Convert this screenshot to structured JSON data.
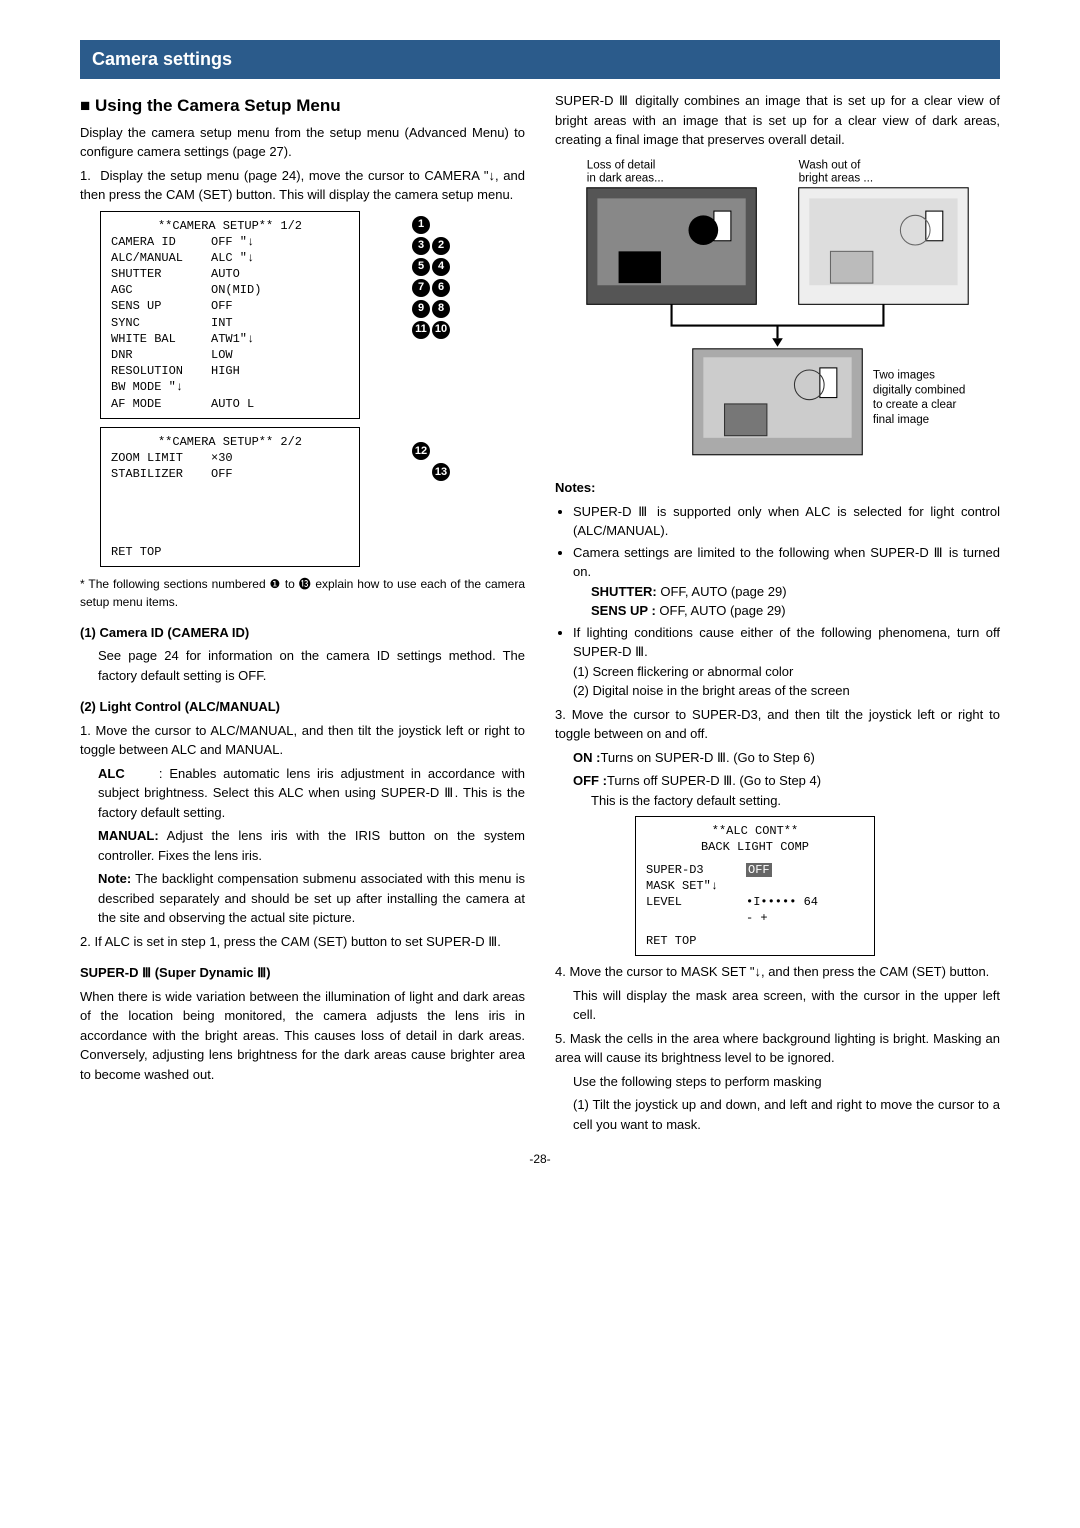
{
  "title_bar": "Camera settings",
  "left": {
    "h_using": "Using the Camera Setup Menu",
    "intro": "Display the camera setup menu from the setup menu (Advanced Menu) to configure camera settings (page 27).",
    "step1": "Display the setup menu (page 24), move the cursor to CAMERA \"↓, and then press the CAM (SET) button. This will display the camera setup menu.",
    "osd1": {
      "header": "**CAMERA SETUP** 1/2",
      "rows": [
        {
          "lbl": "CAMERA ID",
          "val": "OFF \"↓"
        },
        {
          "lbl": "ALC/MANUAL",
          "val": "ALC \"↓"
        },
        {
          "lbl": "SHUTTER",
          "val": "AUTO"
        },
        {
          "lbl": "AGC",
          "val": "ON(MID)"
        },
        {
          "lbl": "SENS UP",
          "val": "OFF"
        },
        {
          "lbl": "SYNC",
          "val": "INT"
        },
        {
          "lbl": "WHITE BAL",
          "val": "ATW1\"↓"
        },
        {
          "lbl": "DNR",
          "val": "LOW"
        },
        {
          "lbl": "RESOLUTION",
          "val": "HIGH"
        },
        {
          "lbl": "BW MODE \"↓",
          "val": ""
        },
        {
          "lbl": "AF MODE",
          "val": "AUTO L"
        }
      ]
    },
    "osd2": {
      "header": "**CAMERA SETUP** 2/2",
      "rows": [
        {
          "lbl": "ZOOM LIMIT",
          "val": "×30"
        },
        {
          "lbl": "STABILIZER",
          "val": "OFF"
        }
      ],
      "footer": "RET TOP"
    },
    "footnote": "* The following sections numbered ❶ to ⓭ explain how to use each of the camera setup menu items.",
    "sec1_h": "(1) Camera ID (CAMERA ID)",
    "sec1_p": "See page 24 for information on the camera ID settings method. The factory default setting is OFF.",
    "sec2_h": "(2) Light Control (ALC/MANUAL)",
    "sec2_s1": "Move the cursor to ALC/MANUAL, and then tilt the joystick left or right to toggle between ALC and MANUAL.",
    "alc_lbl": "ALC",
    "alc_txt": ": Enables automatic lens iris adjustment in accordance with subject brightness. Select this ALC when using SUPER-D Ⅲ. This is the factory default setting.",
    "man_lbl": "MANUAL:",
    "man_txt": " Adjust the lens iris with the IRIS button on the system controller. Fixes the lens iris.",
    "note_lbl": "Note:",
    "note_txt": " The backlight compensation submenu associated with this menu is described separately and should be set up after installing the camera at the site and observing the actual site picture.",
    "sec2_s2": "If ALC is set in step 1, press the CAM (SET) button to set SUPER-D Ⅲ.",
    "sd3_h": "SUPER-D Ⅲ (Super Dynamic Ⅲ)",
    "sd3_p": "When there is wide variation between the illumination of light and dark areas of the location being monitored, the camera adjusts the lens iris in accordance with the bright areas. This causes loss of detail in dark areas. Conversely, adjusting lens brightness for the dark areas cause brighter area to become washed out."
  },
  "right": {
    "sd3_cont": "SUPER-D Ⅲ digitally combines an image that is set up for a clear view of bright areas with an image that is set up for a clear view of dark areas, creating a final image that preserves overall detail.",
    "fig": {
      "lbl_dark": "Loss of detail\nin dark areas...",
      "lbl_bright": "Wash out of\nbright areas ...",
      "lbl_combined": "Two images digitally combined to create a clear final image"
    },
    "notes_h": "Notes:",
    "note1": "SUPER-D Ⅲ is supported only when ALC is selected for light control (ALC/MANUAL).",
    "note2": "Camera settings are limited to the following when SUPER-D Ⅲ is turned on.",
    "n2_shutter_l": "SHUTTER:",
    "n2_shutter_v": "OFF, AUTO (page 29)",
    "n2_sens_l": "SENS UP :",
    "n2_sens_v": "OFF, AUTO (page 29)",
    "note3": "If lighting conditions cause either of the following phenomena, turn off SUPER-D Ⅲ.",
    "n3_1": "(1) Screen flickering or abnormal color",
    "n3_2": "(2) Digital noise in the bright areas of the screen",
    "step3": "Move the cursor to SUPER-D3, and then tilt the joystick left or right to toggle between on and off.",
    "on_l": "ON  :",
    "on_v": "Turns on SUPER-D Ⅲ. (Go to Step 6)",
    "off_l": "OFF :",
    "off_v": "Turns off SUPER-D Ⅲ. (Go to Step 4)",
    "off_v2": "This is the factory default setting.",
    "osd3": {
      "h1": "**ALC CONT**",
      "h2": "BACK LIGHT COMP",
      "r1_l": "SUPER-D3",
      "r1_v": "OFF",
      "r2_l": "MASK SET\"↓",
      "r2_v": "",
      "r3_l": "LEVEL",
      "r3_v": "•I••••• 64",
      "r3_v2": "-       +",
      "footer": "RET TOP"
    },
    "step4": "Move the cursor to MASK SET \"↓, and then press the CAM (SET) button.",
    "step4b": "This will display the mask area screen, with the cursor in the upper left cell.",
    "step5": "Mask the cells in the area where background lighting is bright. Masking an area will cause its brightness level to be ignored.",
    "step5b": "Use the following steps to perform masking",
    "step5_1": "(1) Tilt the joystick up and down, and left and right to move the cursor to a cell you want to mask."
  },
  "page": "-28-"
}
